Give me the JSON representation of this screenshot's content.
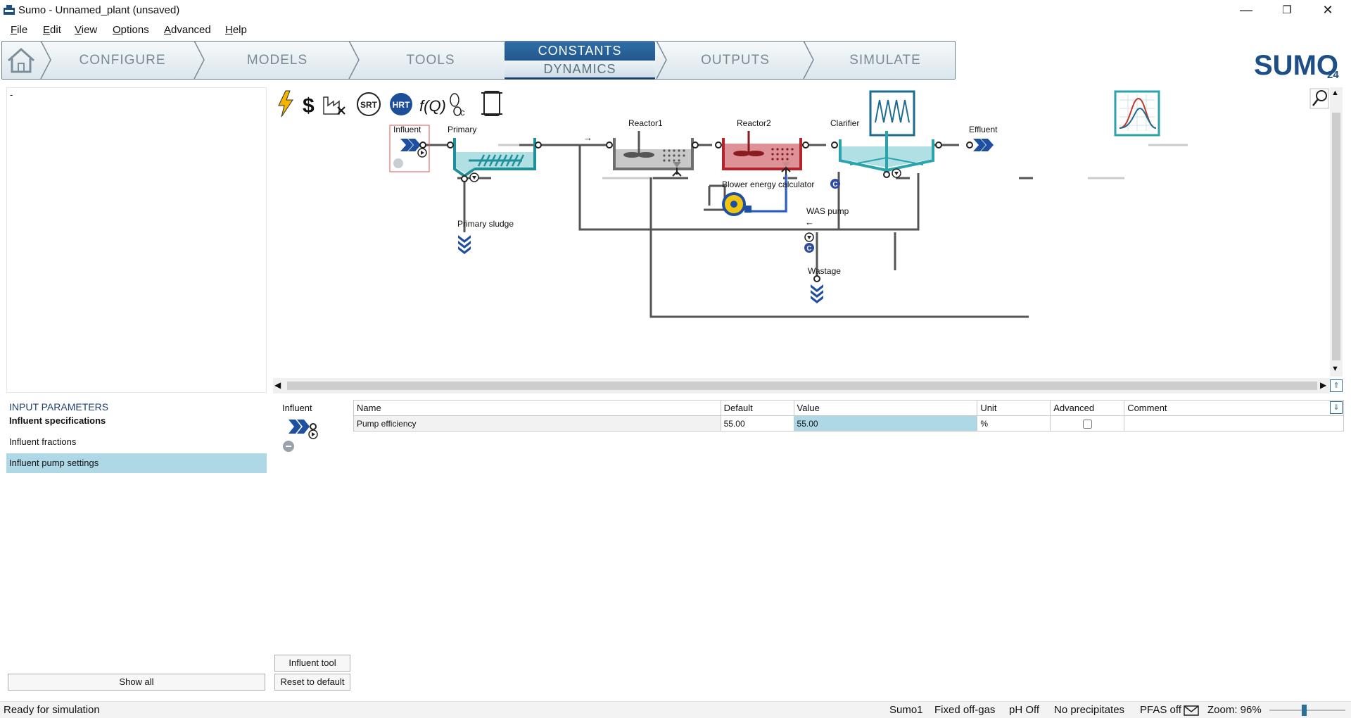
{
  "window": {
    "title": "Sumo - Unnamed_plant (unsaved)"
  },
  "menu": [
    "File",
    "Edit",
    "View",
    "Options",
    "Advanced",
    "Help"
  ],
  "tabs": {
    "configure": "CONFIGURE",
    "models": "MODELS",
    "tools": "TOOLS",
    "constants": "CONSTANTS",
    "dynamics": "DYNAMICS",
    "outputs": "OUTPUTS",
    "simulate": "SIMULATE"
  },
  "brand": {
    "name": "SUMO",
    "version": "24"
  },
  "left_top": {
    "text": "-"
  },
  "toolbar_icons": [
    "energy-icon",
    "cost-icon",
    "factory-remove-icon",
    "srt-icon",
    "hrt-icon",
    "function-icon",
    "footprint-icon",
    "scroll-icon"
  ],
  "toolbar_labels": {
    "srt": "SRT",
    "hrt": "HRT",
    "fq": "f(Q)"
  },
  "diagram": {
    "labels": {
      "influent": "Influent",
      "primary": "Primary",
      "reactor1": "Reactor1",
      "reactor2": "Reactor2",
      "clarifier": "Clarifier",
      "effluent": "Effluent",
      "primary_sludge": "Primary sludge",
      "blower": "Blower energy calculator",
      "was_pump": "WAS pump",
      "wastage": "Wastage"
    },
    "c_badge": "C",
    "colors": {
      "primary": "#1f8f9a",
      "reactor1": "#6e6e6e",
      "reactor2": "#b3252a",
      "clarifier": "#2aa3ad",
      "arrow": "#1f4fa0"
    }
  },
  "input_parameters": {
    "heading": "INPUT PARAMETERS",
    "items": [
      "Influent specifications",
      "Influent fractions",
      "Influent pump settings"
    ],
    "selected_index": 2,
    "show_all": "Show all"
  },
  "params_panel": {
    "element": "Influent",
    "columns": [
      "Name",
      "Default",
      "Value",
      "Unit",
      "Advanced",
      "Comment"
    ],
    "rows": [
      {
        "name": "Pump efficiency",
        "default": "55.00",
        "value": "55.00",
        "unit": "%",
        "advanced": false,
        "comment": ""
      }
    ],
    "buttons": {
      "tool": "Influent tool",
      "reset": "Reset to default"
    }
  },
  "status": {
    "left": "Ready for simulation",
    "model": "Sumo1",
    "offgas": "Fixed off-gas",
    "ph": "pH Off",
    "precip": "No precipitates",
    "pfas": "PFAS off",
    "zoom": "Zoom: 96%"
  },
  "zoom_level": 0.96
}
